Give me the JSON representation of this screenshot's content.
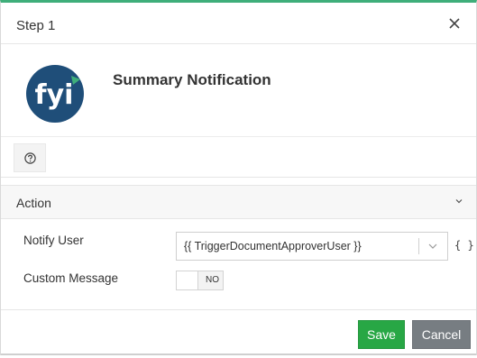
{
  "header": {
    "title": "Step 1",
    "close_icon": "close-icon"
  },
  "app": {
    "name": "Summary Notification",
    "logo_text": "fyi",
    "logo_color": "#1f4e79",
    "logo_accent": "#3fae7a"
  },
  "help": {
    "icon": "question-circle-icon"
  },
  "section": {
    "title": "Action",
    "chevron_icon": "chevron-down-icon"
  },
  "form": {
    "notify_user": {
      "label": "Notify User",
      "value": "{{ TriggerDocumentApproverUser }}",
      "caret_icon": "chevron-down-icon",
      "variable_button_label": "{ }"
    },
    "custom_message": {
      "label": "Custom Message",
      "toggle_text": "NO"
    }
  },
  "footer": {
    "save_label": "Save",
    "cancel_label": "Cancel",
    "save_color": "#28a745",
    "cancel_color": "#777d82"
  }
}
